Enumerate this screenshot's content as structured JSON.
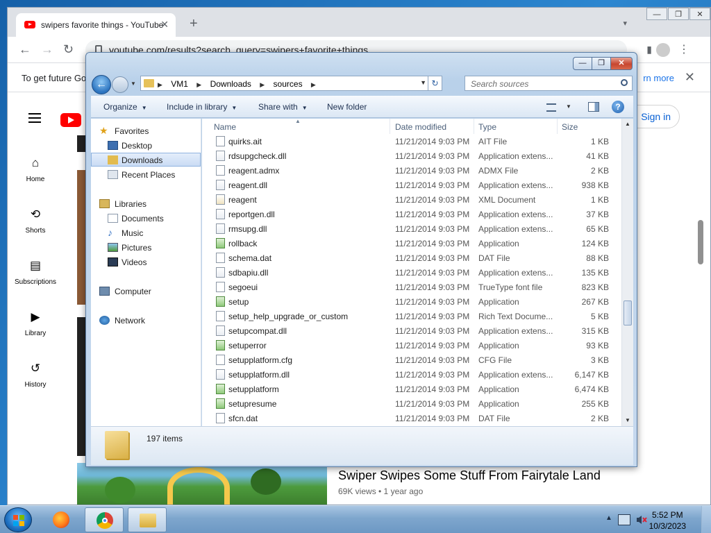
{
  "browser": {
    "tab_title": "swipers favorite things - YouTube",
    "tab_close": "✕",
    "new_tab": "+",
    "url": "youtube.com/results?search_query=swipers+favorite+things",
    "infobar_text": "To get future Go",
    "infobar_more": "rn more",
    "infobar_close": "✕",
    "window_controls": {
      "minimize": "—",
      "maximize": "❐",
      "close": "✕"
    }
  },
  "youtube": {
    "sign_in": "Sign in",
    "sidebar": [
      {
        "label": "Home",
        "icon": "home-icon",
        "glyph": "⌂"
      },
      {
        "label": "Shorts",
        "icon": "shorts-icon",
        "glyph": "⟲"
      },
      {
        "label": "Subscriptions",
        "icon": "subscriptions-icon",
        "glyph": "▤"
      },
      {
        "label": "Library",
        "icon": "library-icon",
        "glyph": "▶"
      },
      {
        "label": "History",
        "icon": "history-icon",
        "glyph": "↺"
      }
    ],
    "video_title": "Swiper Swipes Some Stuff From Fairytale Land",
    "video_meta": "69K views • 1 year ago"
  },
  "explorer": {
    "window_controls": {
      "minimize": "—",
      "maximize": "❐",
      "close": "✕"
    },
    "breadcrumb": [
      "VM1",
      "Downloads",
      "sources"
    ],
    "search_placeholder": "Search sources",
    "commands": {
      "organize": "Organize",
      "include": "Include in library",
      "share": "Share with",
      "new_folder": "New folder"
    },
    "nav": {
      "favorites": "Favorites",
      "desktop": "Desktop",
      "downloads": "Downloads",
      "recent": "Recent Places",
      "libraries": "Libraries",
      "documents": "Documents",
      "music": "Music",
      "pictures": "Pictures",
      "videos": "Videos",
      "computer": "Computer",
      "network": "Network"
    },
    "columns": {
      "name": "Name",
      "date": "Date modified",
      "type": "Type",
      "size": "Size"
    },
    "files": [
      {
        "name": "quirks.ait",
        "date": "11/21/2014 9:03 PM",
        "type": "AIT File",
        "size": "1 KB",
        "icon": "file"
      },
      {
        "name": "rdsupgcheck.dll",
        "date": "11/21/2014 9:03 PM",
        "type": "Application extens...",
        "size": "41 KB",
        "icon": "dll"
      },
      {
        "name": "reagent.admx",
        "date": "11/21/2014 9:03 PM",
        "type": "ADMX File",
        "size": "2 KB",
        "icon": "file"
      },
      {
        "name": "reagent.dll",
        "date": "11/21/2014 9:03 PM",
        "type": "Application extens...",
        "size": "938 KB",
        "icon": "dll"
      },
      {
        "name": "reagent",
        "date": "11/21/2014 9:03 PM",
        "type": "XML Document",
        "size": "1 KB",
        "icon": "xml"
      },
      {
        "name": "reportgen.dll",
        "date": "11/21/2014 9:03 PM",
        "type": "Application extens...",
        "size": "37 KB",
        "icon": "dll"
      },
      {
        "name": "rmsupg.dll",
        "date": "11/21/2014 9:03 PM",
        "type": "Application extens...",
        "size": "65 KB",
        "icon": "dll"
      },
      {
        "name": "rollback",
        "date": "11/21/2014 9:03 PM",
        "type": "Application",
        "size": "124 KB",
        "icon": "app"
      },
      {
        "name": "schema.dat",
        "date": "11/21/2014 9:03 PM",
        "type": "DAT File",
        "size": "88 KB",
        "icon": "file"
      },
      {
        "name": "sdbapiu.dll",
        "date": "11/21/2014 9:03 PM",
        "type": "Application extens...",
        "size": "135 KB",
        "icon": "dll"
      },
      {
        "name": "segoeui",
        "date": "11/21/2014 9:03 PM",
        "type": "TrueType font file",
        "size": "823 KB",
        "icon": "file"
      },
      {
        "name": "setup",
        "date": "11/21/2014 9:03 PM",
        "type": "Application",
        "size": "267 KB",
        "icon": "app"
      },
      {
        "name": "setup_help_upgrade_or_custom",
        "date": "11/21/2014 9:03 PM",
        "type": "Rich Text Docume...",
        "size": "5 KB",
        "icon": "file"
      },
      {
        "name": "setupcompat.dll",
        "date": "11/21/2014 9:03 PM",
        "type": "Application extens...",
        "size": "315 KB",
        "icon": "dll"
      },
      {
        "name": "setuperror",
        "date": "11/21/2014 9:03 PM",
        "type": "Application",
        "size": "93 KB",
        "icon": "app"
      },
      {
        "name": "setupplatform.cfg",
        "date": "11/21/2014 9:03 PM",
        "type": "CFG File",
        "size": "3 KB",
        "icon": "file"
      },
      {
        "name": "setupplatform.dll",
        "date": "11/21/2014 9:03 PM",
        "type": "Application extens...",
        "size": "6,147 KB",
        "icon": "dll"
      },
      {
        "name": "setupplatform",
        "date": "11/21/2014 9:03 PM",
        "type": "Application",
        "size": "6,474 KB",
        "icon": "app"
      },
      {
        "name": "setupresume",
        "date": "11/21/2014 9:03 PM",
        "type": "Application",
        "size": "255 KB",
        "icon": "app"
      },
      {
        "name": "sfcn.dat",
        "date": "11/21/2014 9:03 PM",
        "type": "DAT File",
        "size": "2 KB",
        "icon": "file"
      }
    ],
    "item_count": "197 items"
  },
  "taskbar": {
    "time": "5:52 PM",
    "date": "10/3/2023",
    "apps": [
      "firefox",
      "chrome",
      "file-explorer"
    ]
  },
  "colors": {
    "youtube_red": "#ff0000",
    "link_blue": "#065fd4",
    "win7_taskbar": "#7ea6cd"
  }
}
